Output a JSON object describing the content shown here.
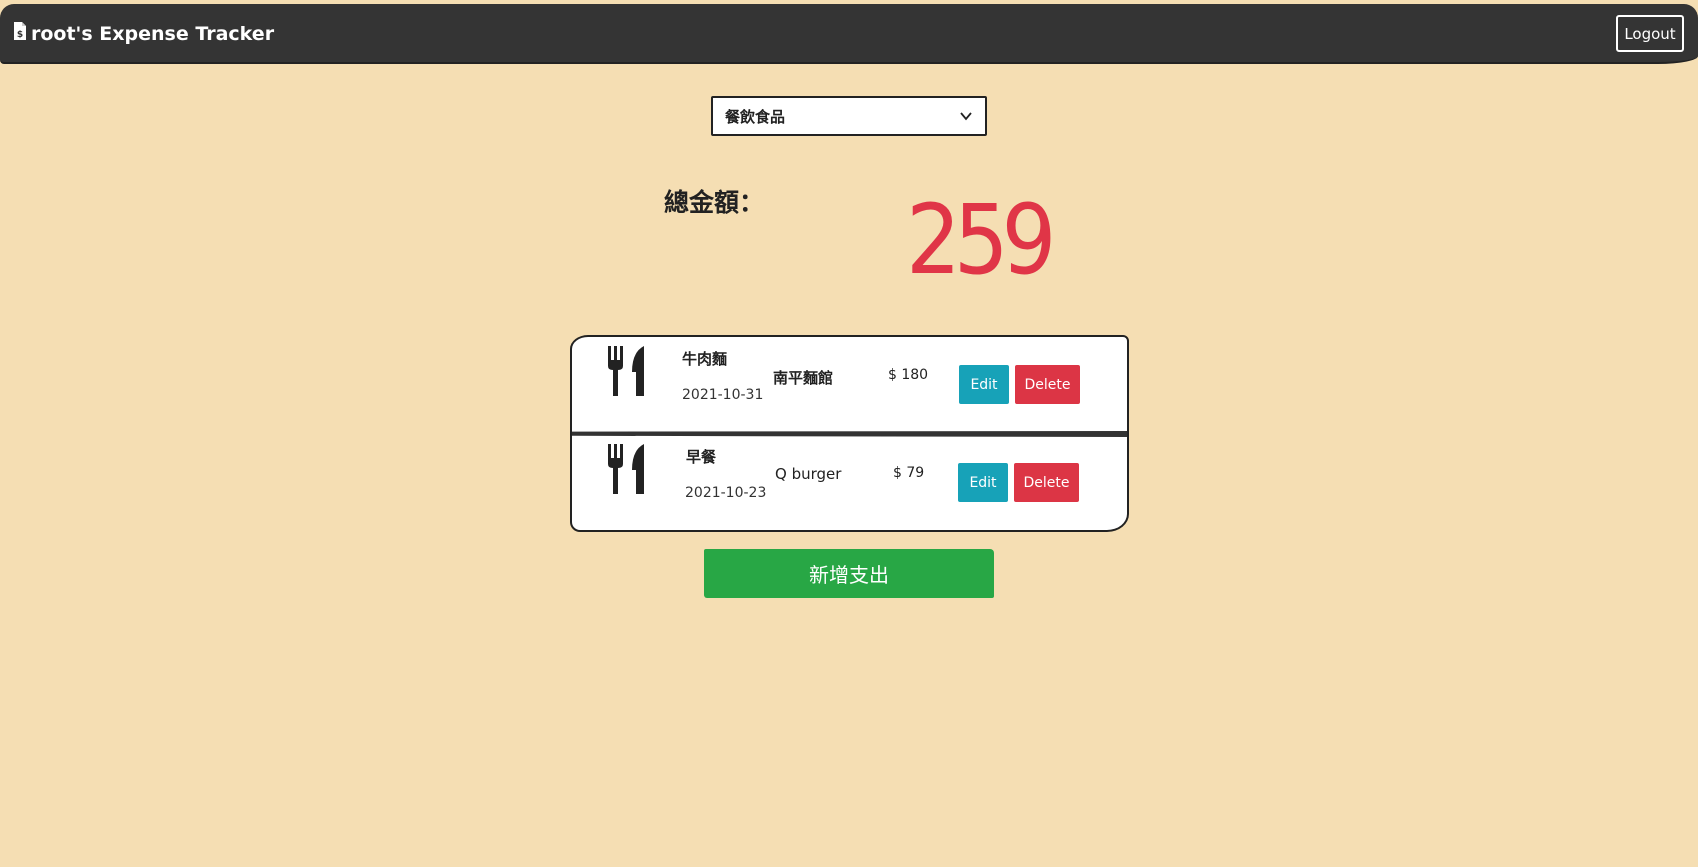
{
  "navbar": {
    "brand": "root's Expense Tracker",
    "brand_icon": "file-invoice-dollar-icon",
    "logout_label": "Logout"
  },
  "filter": {
    "selected_category": "餐飲食品"
  },
  "summary": {
    "total_label": "總金額：",
    "total_amount": "259"
  },
  "records": [
    {
      "icon": "utensils-icon",
      "name": "牛肉麵",
      "date": "2021-10-31",
      "merchant": "南平麵館",
      "amount": "$ 180",
      "edit_label": "Edit",
      "delete_label": "Delete"
    },
    {
      "icon": "utensils-icon",
      "name": "早餐",
      "date": "2021-10-23",
      "merchant": "Q burger",
      "amount": "$ 79",
      "edit_label": "Edit",
      "delete_label": "Delete"
    }
  ],
  "add_button_label": "新增支出",
  "colors": {
    "background": "#f5deb3",
    "navbar": "#343434",
    "total_amount": "#e03547",
    "edit": "#17a2b8",
    "delete": "#dc3545",
    "add": "#28a745"
  }
}
